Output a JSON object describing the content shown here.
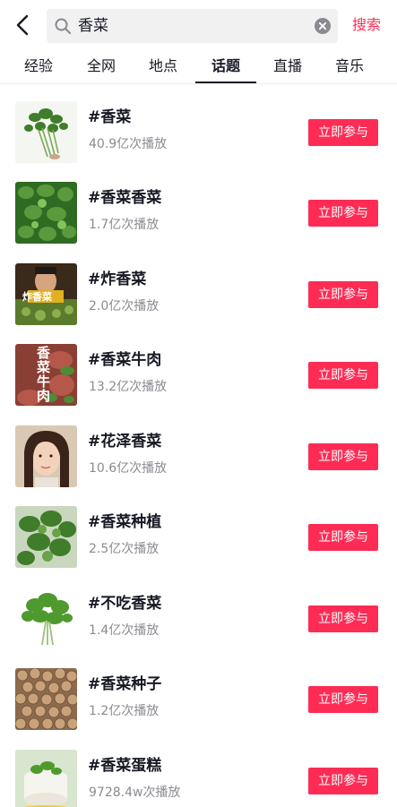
{
  "search": {
    "query": "香菜",
    "submit_label": "搜索"
  },
  "tabs": [
    {
      "label": "经验"
    },
    {
      "label": "全网"
    },
    {
      "label": "地点"
    },
    {
      "label": "话题",
      "active": true
    },
    {
      "label": "直播"
    },
    {
      "label": "音乐"
    }
  ],
  "topics": [
    {
      "title": "#香菜",
      "stats": "40.9亿次播放",
      "join_label": "立即参与",
      "thumb_desc": "cilantro bunch on white"
    },
    {
      "title": "#香菜香菜",
      "stats": "1.7亿次播放",
      "join_label": "立即参与",
      "thumb_desc": "cilantro leaves close-up"
    },
    {
      "title": "#炸香菜",
      "stats": "2.0亿次播放",
      "join_label": "立即参与",
      "thumb_desc": "fried cilantro",
      "thumb_text": "炸香菜"
    },
    {
      "title": "#香菜牛肉",
      "stats": "13.2亿次播放",
      "join_label": "立即参与",
      "thumb_desc": "cilantro beef",
      "thumb_text": "香菜牛肉"
    },
    {
      "title": "#花泽香菜",
      "stats": "10.6亿次播放",
      "join_label": "立即参与",
      "thumb_desc": "portrait"
    },
    {
      "title": "#香菜种植",
      "stats": "2.5亿次播放",
      "join_label": "立即参与",
      "thumb_desc": "cilantro plant"
    },
    {
      "title": "#不吃香菜",
      "stats": "1.4亿次播放",
      "join_label": "立即参与",
      "thumb_desc": "cilantro bunch"
    },
    {
      "title": "#香菜种子",
      "stats": "1.2亿次播放",
      "join_label": "立即参与",
      "thumb_desc": "coriander seeds"
    },
    {
      "title": "#香菜蛋糕",
      "stats": "9728.4w次播放",
      "join_label": "立即参与",
      "thumb_desc": "cilantro cake"
    }
  ],
  "colors": {
    "accent": "#fe2c55",
    "text_primary": "#161823",
    "text_secondary": "#8a8b91",
    "search_bg": "#f1f1f2"
  }
}
